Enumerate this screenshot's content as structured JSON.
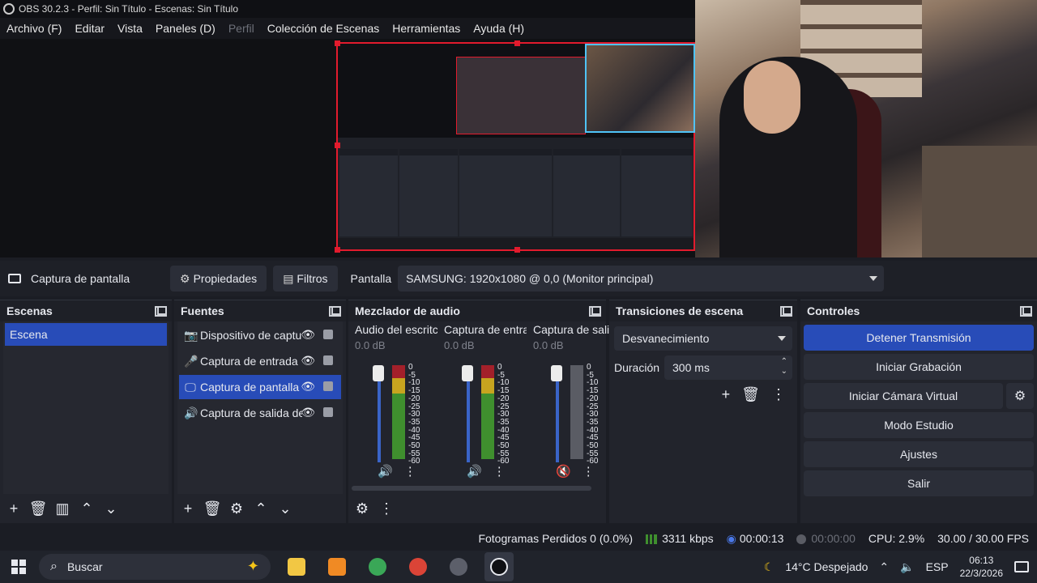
{
  "window": {
    "title": "OBS 30.2.3 - Perfil: Sin Título - Escenas: Sin Título"
  },
  "menu": {
    "items": [
      "Archivo (F)",
      "Editar",
      "Vista",
      "Paneles (D)",
      "Perfil",
      "Colección de Escenas",
      "Herramientas",
      "Ayuda (H)"
    ]
  },
  "source_toolbar": {
    "source_name": "Captura de pantalla",
    "properties_label": "Propiedades",
    "filters_label": "Filtros",
    "display_label": "Pantalla",
    "display_value": "SAMSUNG: 1920x1080 @ 0,0 (Monitor principal)"
  },
  "scenes": {
    "title": "Escenas",
    "items": [
      "Escena"
    ]
  },
  "sources": {
    "title": "Fuentes",
    "items": [
      {
        "label": "Dispositivo de captu",
        "icon": "camera-icon"
      },
      {
        "label": "Captura de entrada",
        "icon": "microphone-icon"
      },
      {
        "label": "Captura de pantalla",
        "icon": "monitor-icon"
      },
      {
        "label": "Captura de salida de",
        "icon": "speaker-icon"
      }
    ]
  },
  "mixer": {
    "title": "Mezclador de audio",
    "channels": [
      {
        "name": "Audio del escritc",
        "db": "0.0 dB"
      },
      {
        "name": "Captura de entra",
        "db": "0.0 dB"
      },
      {
        "name": "Captura de sali",
        "db": "0.0 dB"
      }
    ],
    "scale": [
      "0",
      "-5",
      "-10",
      "-15",
      "-20",
      "-25",
      "-30",
      "-35",
      "-40",
      "-45",
      "-50",
      "-55",
      "-60"
    ]
  },
  "transitions": {
    "title": "Transiciones de escena",
    "selected": "Desvanecimiento",
    "duration_label": "Duración",
    "duration_value": "300 ms"
  },
  "controls": {
    "title": "Controles",
    "stop_stream": "Detener Transmisión",
    "start_recording": "Iniciar Grabación",
    "start_virtual_cam": "Iniciar Cámara Virtual",
    "studio_mode": "Modo Estudio",
    "settings": "Ajustes",
    "exit": "Salir"
  },
  "status": {
    "dropped_frames": "Fotogramas Perdidos 0 (0.0%)",
    "bitrate": "3311 kbps",
    "stream_time": "00:00:13",
    "record_time": "00:00:00",
    "cpu": "CPU: 2.9%",
    "fps": "30.00 / 30.00 FPS"
  },
  "taskbar": {
    "search_placeholder": "Buscar",
    "weather": "14°C  Despejado",
    "language": "ESP",
    "time": "06:13",
    "date": "22/3/2026"
  },
  "colors": {
    "accent": "#284cb8",
    "selection_border": "#e21b2d",
    "app_bg": "#22242c"
  }
}
